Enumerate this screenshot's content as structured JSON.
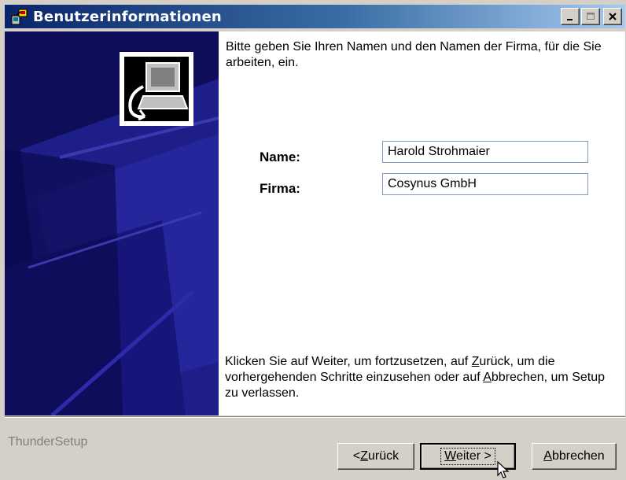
{
  "window": {
    "title": "Benutzerinformationen",
    "controls": {
      "minimize_icon": "minimize-icon",
      "maximize_icon": "maximize-icon",
      "close_icon": "close-icon"
    }
  },
  "content": {
    "intro": "Bitte geben Sie Ihren Namen und den Namen der Firma, für die Sie arbeiten, ein.",
    "name_label": "Name:",
    "name_value": "Harold Strohmaier",
    "company_label": "Firma:",
    "company_value": "Cosynus GmbH",
    "outro": {
      "part1": "Klicken Sie auf Weiter, um fortzusetzen, auf ",
      "back_mnemonic": "Z",
      "part2": "urück, um die vorhergehenden Schritte einzusehen oder auf ",
      "cancel_mnemonic": "A",
      "part3": "bbrechen, um Setup zu verlassen."
    }
  },
  "footer": {
    "brand": "ThunderSetup",
    "back": {
      "prefix": "< ",
      "mnemonic": "Z",
      "rest": "urück"
    },
    "next": {
      "mnemonic": "W",
      "rest": "eiter",
      "suffix": " >"
    },
    "cancel": {
      "mnemonic": "A",
      "rest": "bbrechen"
    }
  },
  "colors": {
    "titlebar_start": "#0a246a",
    "sidebar": "#0d0d5a",
    "face": "#d4d0c8"
  }
}
